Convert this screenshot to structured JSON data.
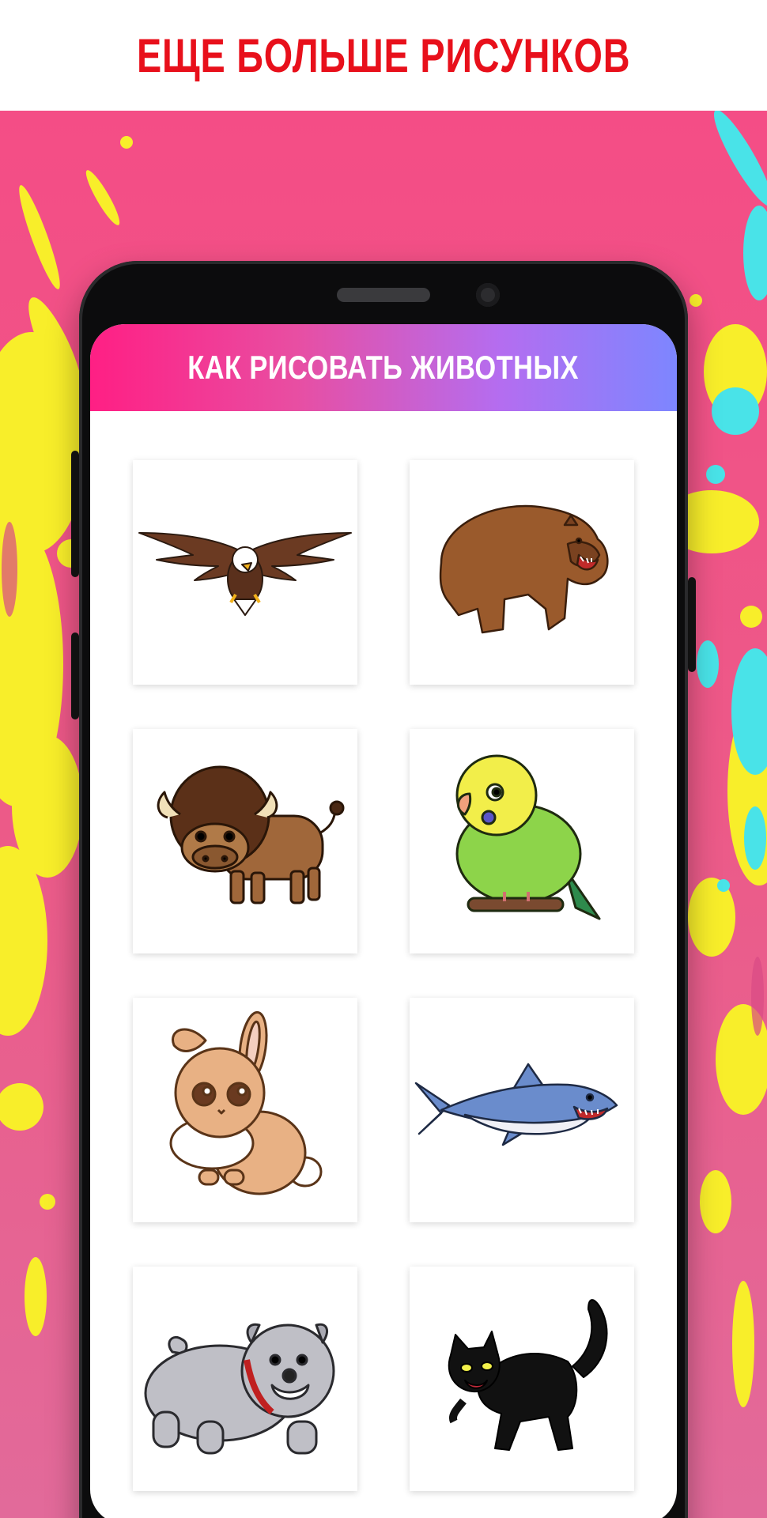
{
  "header": {
    "title": "ЕЩЕ БОЛЬШЕ РИСУНКОВ"
  },
  "app": {
    "title": "КАК РИСОВАТЬ ЖИВОТНЫХ",
    "accent_gradient": [
      "#ff1f84",
      "#b46df0",
      "#7d86ff"
    ]
  },
  "colors": {
    "header_text": "#e8101b",
    "backdrop": "#f44d86",
    "splash_yellow": "#f8ee2a",
    "splash_cyan": "#49e3e8"
  },
  "animals": [
    {
      "icon": "eagle-icon"
    },
    {
      "icon": "bear-icon"
    },
    {
      "icon": "bison-icon"
    },
    {
      "icon": "parrot-icon"
    },
    {
      "icon": "rabbit-icon"
    },
    {
      "icon": "shark-icon"
    },
    {
      "icon": "bulldog-icon"
    },
    {
      "icon": "cat-icon"
    }
  ]
}
